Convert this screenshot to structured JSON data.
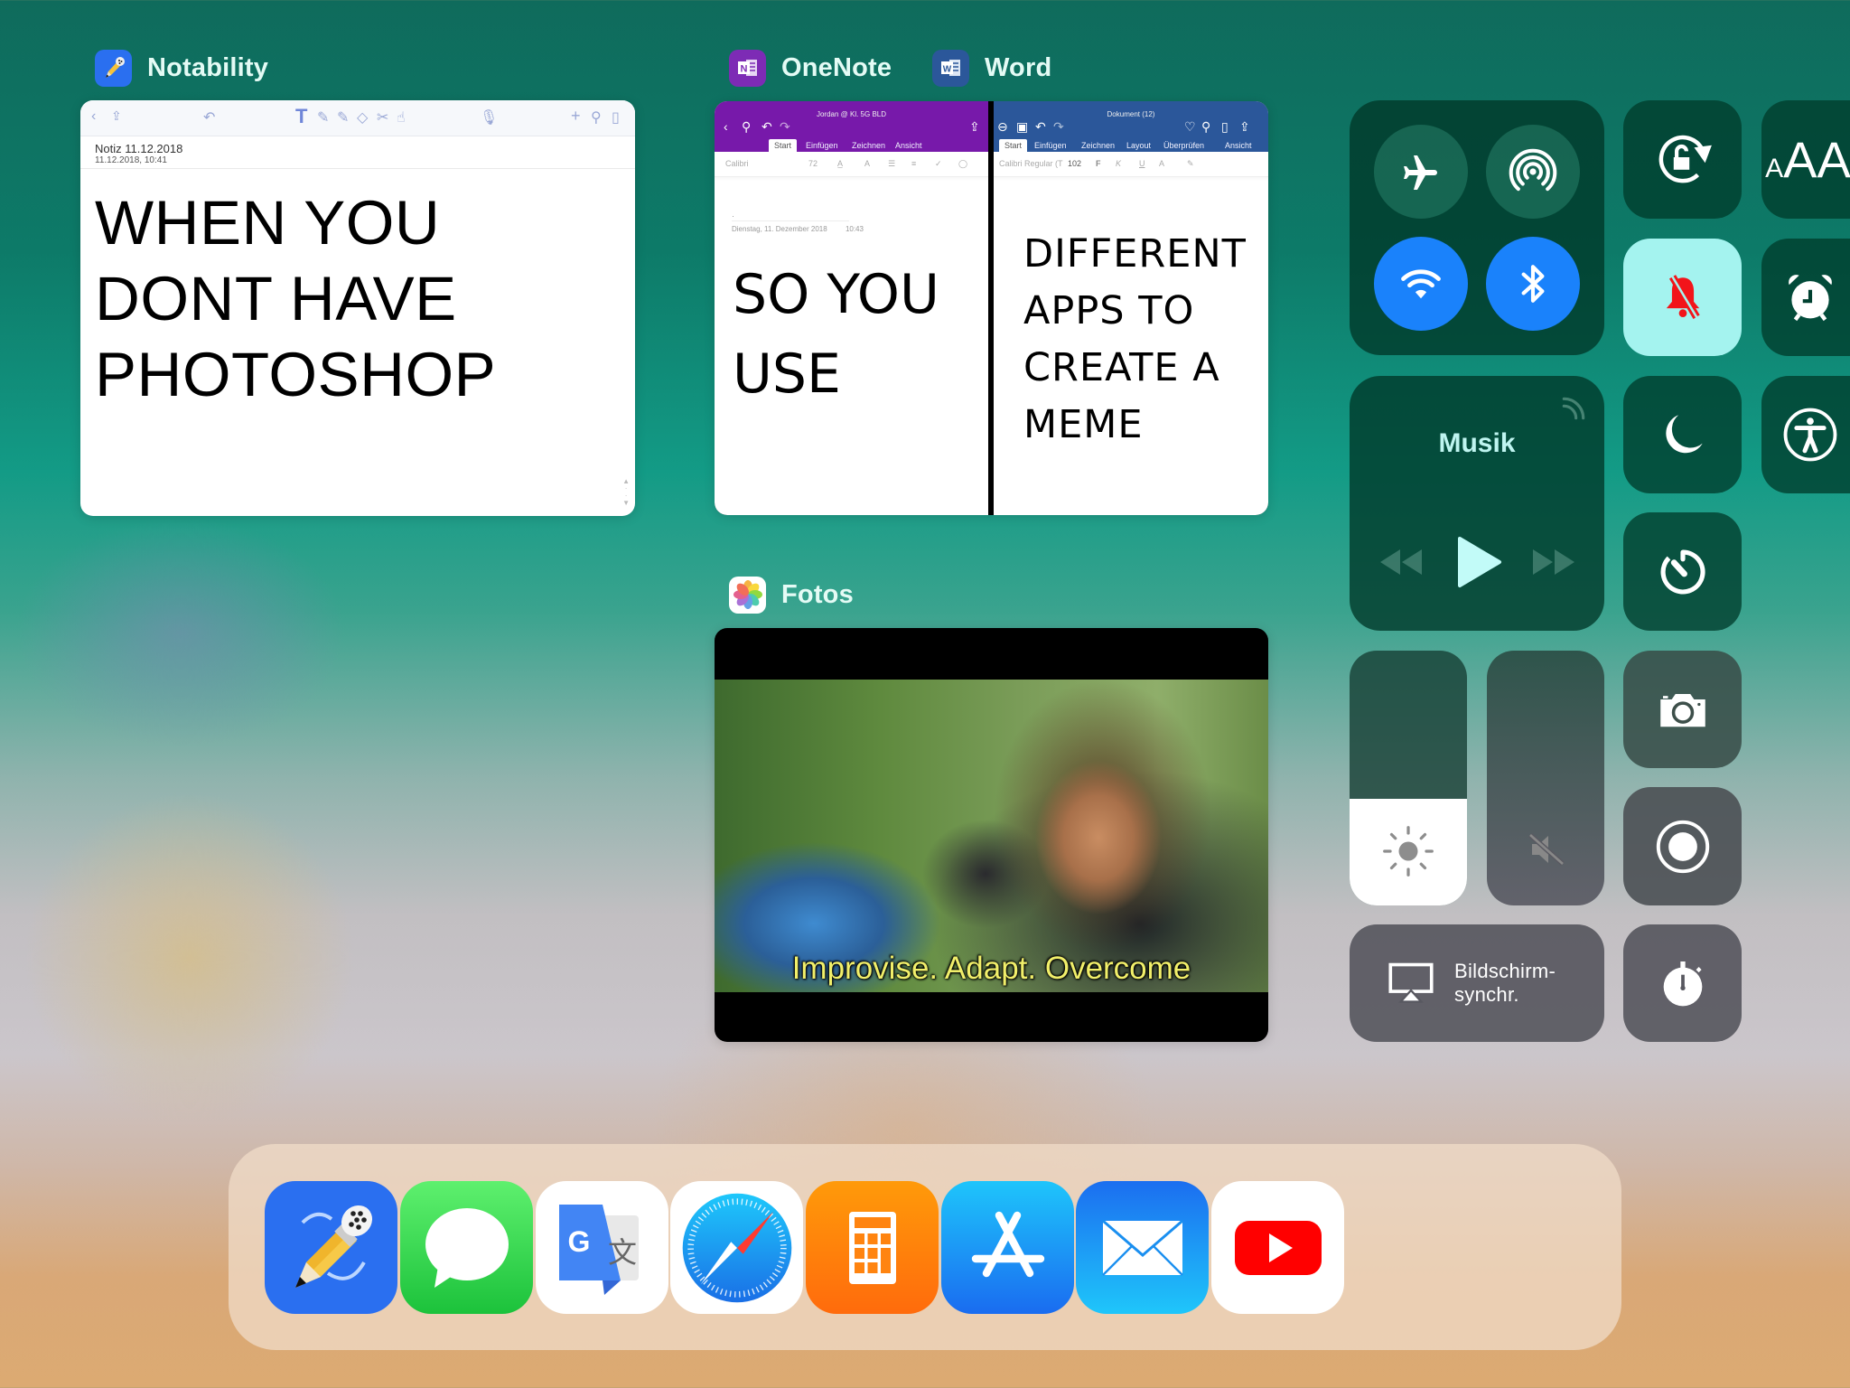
{
  "app_switcher": {
    "notability": {
      "label": "Notability",
      "toolbar_icons": [
        "back-icon",
        "share-icon",
        "undo-icon",
        "text-tool-icon",
        "pen-icon",
        "highlighter-icon",
        "eraser-icon",
        "scissors-icon",
        "hand-icon",
        "microphone-icon",
        "add-icon",
        "tools-icon",
        "pages-icon"
      ],
      "note_title": "Notiz 11.12.2018",
      "note_date": "11.12.2018, 10:41",
      "content_lines": [
        "WHEN YOU",
        "DONT HAVE",
        "PHOTOSHOP"
      ]
    },
    "onenote": {
      "label": "OneNote",
      "doc_title": "Jordan @ Kl. 5G BLD",
      "tabs": [
        "Start",
        "Einfügen",
        "Zeichnen",
        "Ansicht"
      ],
      "active_tab": "Start",
      "font_name": "Calibri",
      "font_size": "72",
      "page_date": "Dienstag, 11. Dezember 2018",
      "page_time": "10:43",
      "content_lines": [
        "SO YOU",
        "USE"
      ],
      "accent": "#7719aa"
    },
    "word": {
      "label": "Word",
      "doc_title": "Dokument (12)",
      "tabs": [
        "Start",
        "Einfügen",
        "Zeichnen",
        "Layout",
        "Überprüfen",
        "Ansicht"
      ],
      "active_tab": "Start",
      "font_name": "Calibri Regular (T",
      "font_size": "102",
      "format_buttons": [
        "F",
        "K",
        "U",
        "A"
      ],
      "content_lines": [
        "DIFFERENT",
        "APPS TO",
        "CREATE A",
        "MEME"
      ],
      "accent": "#2b579a"
    },
    "fotos": {
      "label": "Fotos",
      "caption": "Improvise. Adapt. Overcome"
    }
  },
  "control_center": {
    "airplane": {
      "icon": "airplane-icon",
      "state": "off"
    },
    "airdrop": {
      "icon": "airdrop-icon",
      "state": "off"
    },
    "wifi": {
      "icon": "wifi-icon",
      "state": "on"
    },
    "bluetooth": {
      "icon": "bluetooth-icon",
      "state": "on"
    },
    "rotation_lock": {
      "icon": "rotation-lock-icon"
    },
    "text_size": {
      "icon": "text-size-icon",
      "label": "AA"
    },
    "silent": {
      "icon": "bell-slash-icon",
      "state": "on"
    },
    "alarm": {
      "icon": "alarm-clock-icon"
    },
    "music": {
      "title": "Musik"
    },
    "do_not_disturb": {
      "icon": "moon-icon"
    },
    "accessibility": {
      "icon": "accessibility-icon"
    },
    "timer": {
      "icon": "timer-icon"
    },
    "brightness": {
      "icon": "sun-icon",
      "level": 0.42
    },
    "volume": {
      "icon": "speaker-muted-icon",
      "level": 0.0
    },
    "camera": {
      "icon": "camera-icon"
    },
    "screen_record": {
      "icon": "record-icon"
    },
    "screen_mirroring": {
      "icon": "airplay-icon",
      "label_line1": "Bildschirm-",
      "label_line2": "synchr."
    },
    "stopwatch": {
      "icon": "stopwatch-icon"
    }
  },
  "dock": {
    "apps": [
      {
        "name": "Notability",
        "icon": "notability-icon"
      },
      {
        "name": "Nachrichten",
        "icon": "messages-icon"
      },
      {
        "name": "Google Übersetzer",
        "icon": "google-translate-icon"
      },
      {
        "name": "Safari",
        "icon": "safari-icon"
      },
      {
        "name": "Rechner",
        "icon": "calculator-icon"
      },
      {
        "name": "App Store",
        "icon": "app-store-icon"
      },
      {
        "name": "Mail",
        "icon": "mail-icon"
      },
      {
        "name": "YouTube",
        "icon": "youtube-icon"
      }
    ]
  }
}
